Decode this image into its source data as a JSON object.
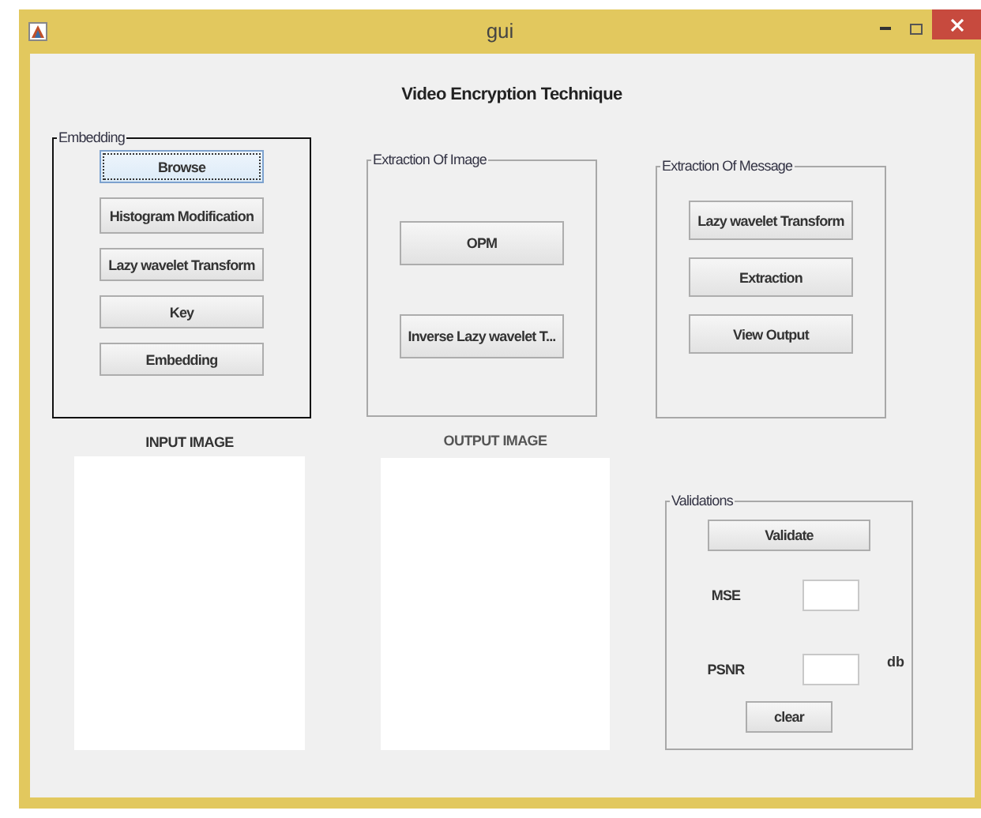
{
  "window": {
    "title": "gui"
  },
  "heading": "Video Encryption Technique",
  "panels": [
    {
      "kind": "buttons",
      "title": "Embedding",
      "selected": true,
      "buttons": [
        {
          "label": "Browse",
          "focused": true
        },
        {
          "label": "Histogram Modification",
          "focused": false
        },
        {
          "label": "Lazy wavelet Transform",
          "focused": false
        },
        {
          "label": "Key",
          "focused": false
        },
        {
          "label": "Embedding",
          "focused": false
        }
      ]
    },
    {
      "kind": "buttons",
      "title": "Extraction Of Image",
      "selected": false,
      "buttons": [
        {
          "label": "OPM",
          "focused": false
        },
        {
          "label": "Inverse Lazy wavelet T...",
          "focused": false
        }
      ]
    },
    {
      "kind": "buttons",
      "title": "Extraction Of Message",
      "selected": false,
      "buttons": [
        {
          "label": "Lazy wavelet Transform",
          "focused": false
        },
        {
          "label": "Extraction",
          "focused": false
        },
        {
          "label": "View Output",
          "focused": false
        }
      ]
    },
    {
      "kind": "validations",
      "title": "Validations",
      "selected": false,
      "validate": "Validate",
      "fields": [
        {
          "label": "MSE"
        },
        {
          "label": "PSNR",
          "unit": "db"
        }
      ],
      "clear": "clear"
    }
  ],
  "images": [
    {
      "label": "INPUT IMAGE"
    },
    {
      "label": "OUTPUT IMAGE"
    }
  ]
}
